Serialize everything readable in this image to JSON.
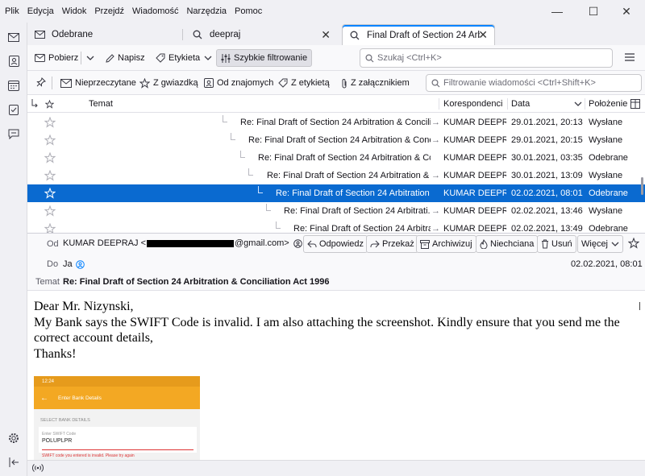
{
  "menubar": {
    "items": [
      "Plik",
      "Edycja",
      "Widok",
      "Przejdź",
      "Wiadomość",
      "Narzędzia",
      "Pomoc"
    ]
  },
  "window_controls": {
    "minimize": "—",
    "maximize": "☐",
    "close": "✕"
  },
  "tabs": [
    {
      "label": "Odebrane",
      "icon": "mail-icon"
    },
    {
      "label": "deepraj",
      "icon": "search-icon",
      "close": "✕"
    },
    {
      "label": "Final Draft of Section 24 Arbitra",
      "icon": "search-icon",
      "close": "✕",
      "active": true
    }
  ],
  "toolbar": {
    "get_mail": "Pobierz",
    "write": "Napisz",
    "tag": "Etykieta",
    "quick_filter": "Szybkie filtrowanie",
    "search_placeholder": "Szukaj <Ctrl+K>"
  },
  "quick_filter": {
    "unread": "Nieprzeczytane",
    "starred": "Z gwiazdką",
    "contact": "Od znajomych",
    "tagged": "Z etykietą",
    "attachment": "Z załącznikiem",
    "filter_placeholder": "Filtrowanie wiadomości <Ctrl+Shift+K>"
  },
  "thread_columns": {
    "subject": "Temat",
    "correspondents": "Korespondenci",
    "date": "Data",
    "location": "Położenie"
  },
  "rows": [
    {
      "subject": "Re: Final Draft of Section 24 Arbitration & Concilia...",
      "arrow": "→",
      "correspondent": "KUMAR DEEPR...",
      "date": "29.01.2021, 20:13",
      "location": "Wysłane"
    },
    {
      "subject": "Re: Final Draft of Section 24 Arbitration & Conc...",
      "arrow": "→",
      "correspondent": "KUMAR DEEPR...",
      "date": "29.01.2021, 20:15",
      "location": "Wysłane"
    },
    {
      "subject": "Re: Final Draft of Section 24 Arbitration & Co...",
      "arrow": "",
      "correspondent": "KUMAR DEEPR...",
      "date": "30.01.2021, 03:35",
      "location": "Odebrane"
    },
    {
      "subject": "Re: Final Draft of Section 24 Arbitration & ...",
      "arrow": "→",
      "correspondent": "KUMAR DEEPR...",
      "date": "30.01.2021, 13:09",
      "location": "Wysłane"
    },
    {
      "subject": "Re: Final Draft of Section 24 Arbitration ...",
      "arrow": "",
      "correspondent": "KUMAR DEEPR...",
      "date": "02.02.2021, 08:01",
      "location": "Odebrane",
      "selected": true
    },
    {
      "subject": "Re: Final Draft of Section 24 Arbitrati...",
      "arrow": "→",
      "correspondent": "KUMAR DEEPR...",
      "date": "02.02.2021, 13:46",
      "location": "Wysłane"
    },
    {
      "subject": "Re: Final Draft of Section 24 Arbitrati...",
      "arrow": "→",
      "correspondent": "KUMAR DEEPR...",
      "date": "02.02.2021, 13:49",
      "location": "Odebrane"
    }
  ],
  "message": {
    "from_label": "Od",
    "from_name": "KUMAR DEEPRAJ <",
    "from_domain": "@gmail.com>",
    "to_label": "Do",
    "to_value": "Ja",
    "subject_label": "Temat",
    "subject": "Re: Final Draft of Section 24 Arbitration & Conciliation Act 1996",
    "date": "02.02.2021, 08:01",
    "actions": {
      "reply": "Odpowiedz",
      "forward": "Przekaż",
      "archive": "Archiwizuj",
      "junk": "Niechciana",
      "delete": "Usuń",
      "more": "Więcej"
    }
  },
  "body": {
    "line1": "Dear Mr. Nizynski,",
    "line2": "My Bank says the SWIFT Code is invalid. I am also attaching the screenshot. Kindly ensure that you send me the correct account details,",
    "line3": "Thanks!"
  },
  "attachment": {
    "status_time": "12:24",
    "title": "Enter Bank Details",
    "section": "SELECT BANK DETAILS",
    "field_label": "Enter SWIFT Code",
    "field_value": "POLUPLPR",
    "error": "SWIFT code you entered is invalid. Please try again"
  },
  "colors": {
    "accent": "#0a84ff",
    "selected_row": "#0a6ad0",
    "app_bar": "#f3a823"
  }
}
